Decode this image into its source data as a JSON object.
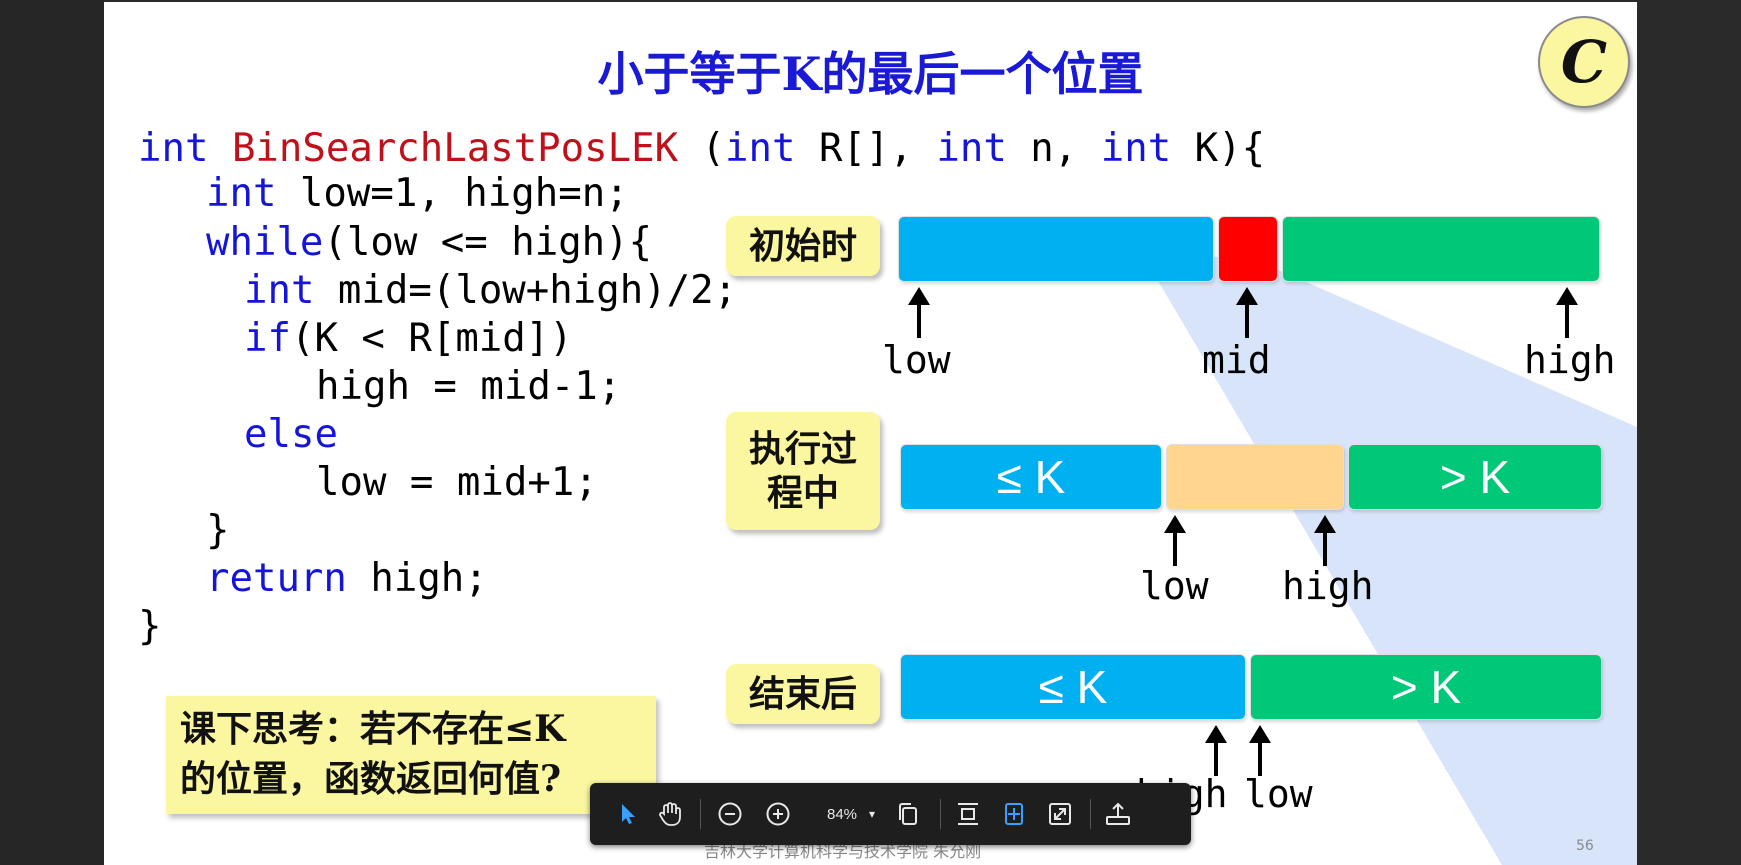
{
  "slide": {
    "title": "小于等于K的最后一个位置",
    "badge": "C",
    "code": {
      "l1_type": "int",
      "l1_fn": "BinSearchLastPosLEK",
      "l1_a": " (",
      "l1_int1": "int",
      "l1_b": " R[], ",
      "l1_int2": "int",
      "l1_c": " n, ",
      "l1_int3": "int",
      "l1_d": " K){",
      "l2_int": "int",
      "l2_rest": " low=1, high=n;",
      "l3_while": "while",
      "l3_rest": "(low <= high){",
      "l4_int": "int",
      "l4_rest": " mid=(low+high)/2;",
      "l5_if": "if",
      "l5_rest": "(K < R[mid])",
      "l6": "high = mid-1;",
      "l7_else": "else",
      "l8": "low = mid+1;",
      "l9": "}",
      "l10_return": "return",
      "l10_rest": " high;",
      "l11": "}"
    },
    "stages": {
      "initial": "初始时",
      "during_1": "执行过",
      "during_2": "程中",
      "end": "结束后"
    },
    "segments": {
      "le_k": "≤ K",
      "gt_k": "> K"
    },
    "labels": {
      "low": "low",
      "mid": "mid",
      "high": "high"
    },
    "think": {
      "line1": "课下思考：若不存在≤K",
      "line2": "的位置，函数返回何值?"
    },
    "footer": "吉林大学计算机科学与技术学院 朱允刚",
    "page_number": "56",
    "colors": {
      "blue": "#00b0f0",
      "red": "#ff0000",
      "green": "#00c878",
      "peach": "#ffd590",
      "highlight": "#fbf7a0",
      "keyword": "#1515d8",
      "function": "#c0101a"
    }
  },
  "toolbar": {
    "zoom": "84%",
    "icons": [
      "select-pointer-icon",
      "hand-pan-icon",
      "zoom-out-icon",
      "zoom-in-icon",
      "zoom-dropdown-icon",
      "copy-pages-icon",
      "fit-height-icon",
      "fit-page-icon",
      "fullscreen-icon",
      "share-upload-icon"
    ]
  }
}
